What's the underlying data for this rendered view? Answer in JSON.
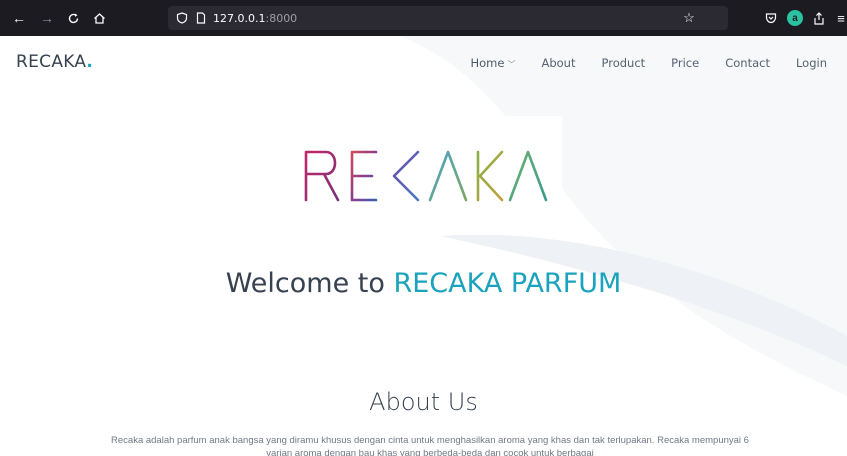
{
  "browser": {
    "url_host": "127.0.0.1",
    "url_port": ":8000",
    "extension_badge": "a"
  },
  "site": {
    "brand": "RECAKA",
    "brand_dot": "."
  },
  "nav": {
    "items": [
      {
        "label": "Home",
        "has_dropdown": true
      },
      {
        "label": "About"
      },
      {
        "label": "Product"
      },
      {
        "label": "Price"
      },
      {
        "label": "Contact"
      },
      {
        "label": "Login"
      }
    ]
  },
  "hero": {
    "logo_text": "RECAKA",
    "welcome_prefix": "Welcome to",
    "welcome_accent": "RECAKA PARFUM"
  },
  "about": {
    "title": "About Us",
    "text": "Recaka adalah parfum anak bangsa yang diramu khusus dengan cinta untuk menghasilkan aroma yang khas dan tak terlupakan. Recaka mempunyai 6 varian aroma dengan bau khas yang berbeda-beda dan cocok untuk berbagai"
  },
  "colors": {
    "accent": "#1aa3bd",
    "text_dark": "#37414f",
    "chrome_bg": "#1c1b22"
  }
}
